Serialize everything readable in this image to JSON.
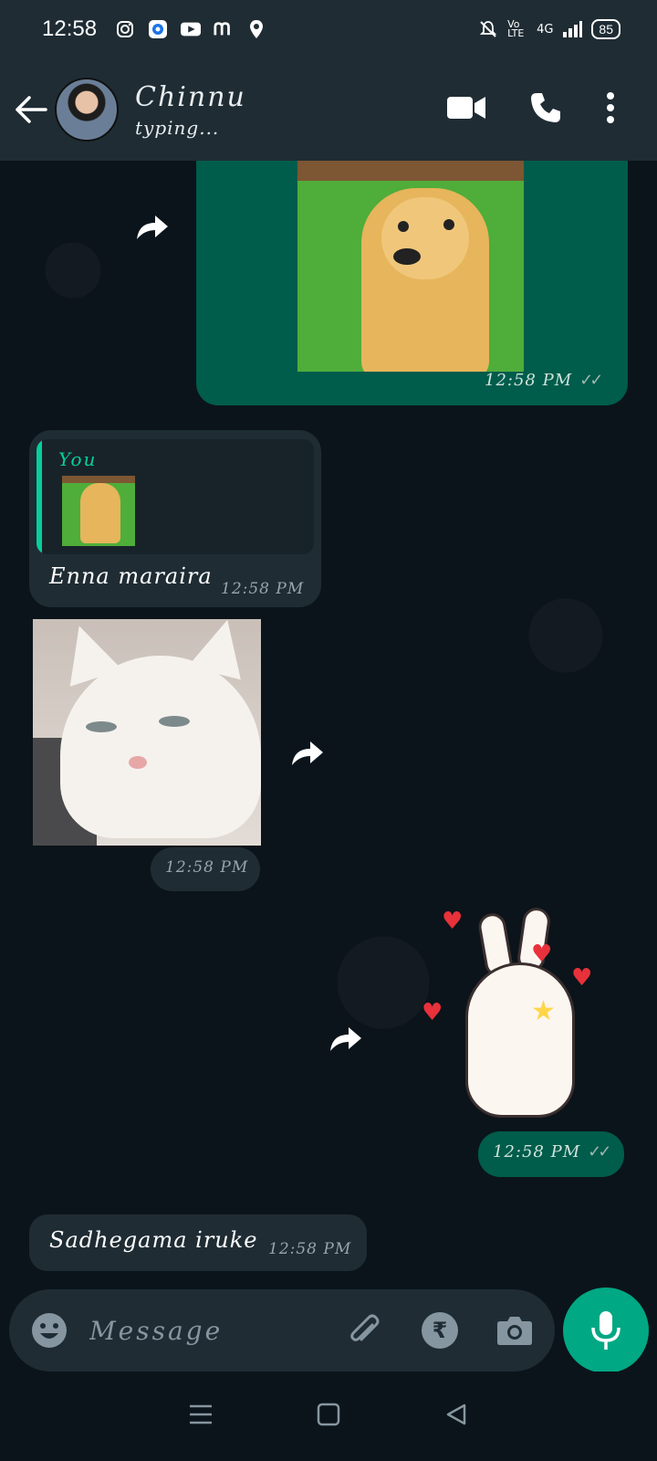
{
  "status_bar": {
    "time": "12:58",
    "network": "4G",
    "volte": "Vo LTE",
    "battery": "85"
  },
  "header": {
    "contact_name": "Chinnu",
    "status": "typing...",
    "icons": [
      "back-arrow-icon",
      "video-call-icon",
      "voice-call-icon",
      "more-options-icon"
    ]
  },
  "messages": [
    {
      "type": "image",
      "direction": "outgoing",
      "time": "12:58 PM",
      "ticks": "✓✓"
    },
    {
      "type": "reply",
      "direction": "incoming",
      "quoted_author": "You",
      "text": "Enna maraira",
      "time": "12:58 PM"
    },
    {
      "type": "image",
      "direction": "incoming",
      "time": "12:58 PM"
    },
    {
      "type": "sticker",
      "direction": "outgoing",
      "time": "12:58 PM",
      "ticks": "✓✓"
    },
    {
      "type": "text",
      "direction": "incoming",
      "text": "Sadhegama iruke",
      "time": "12:58 PM"
    }
  ],
  "composer": {
    "placeholder": "Message",
    "rupee_symbol": "₹"
  },
  "colors": {
    "outgoing_bubble": "#005c4b",
    "incoming_bubble": "#1f2c34",
    "accent": "#00a884",
    "background": "#0b141a"
  }
}
